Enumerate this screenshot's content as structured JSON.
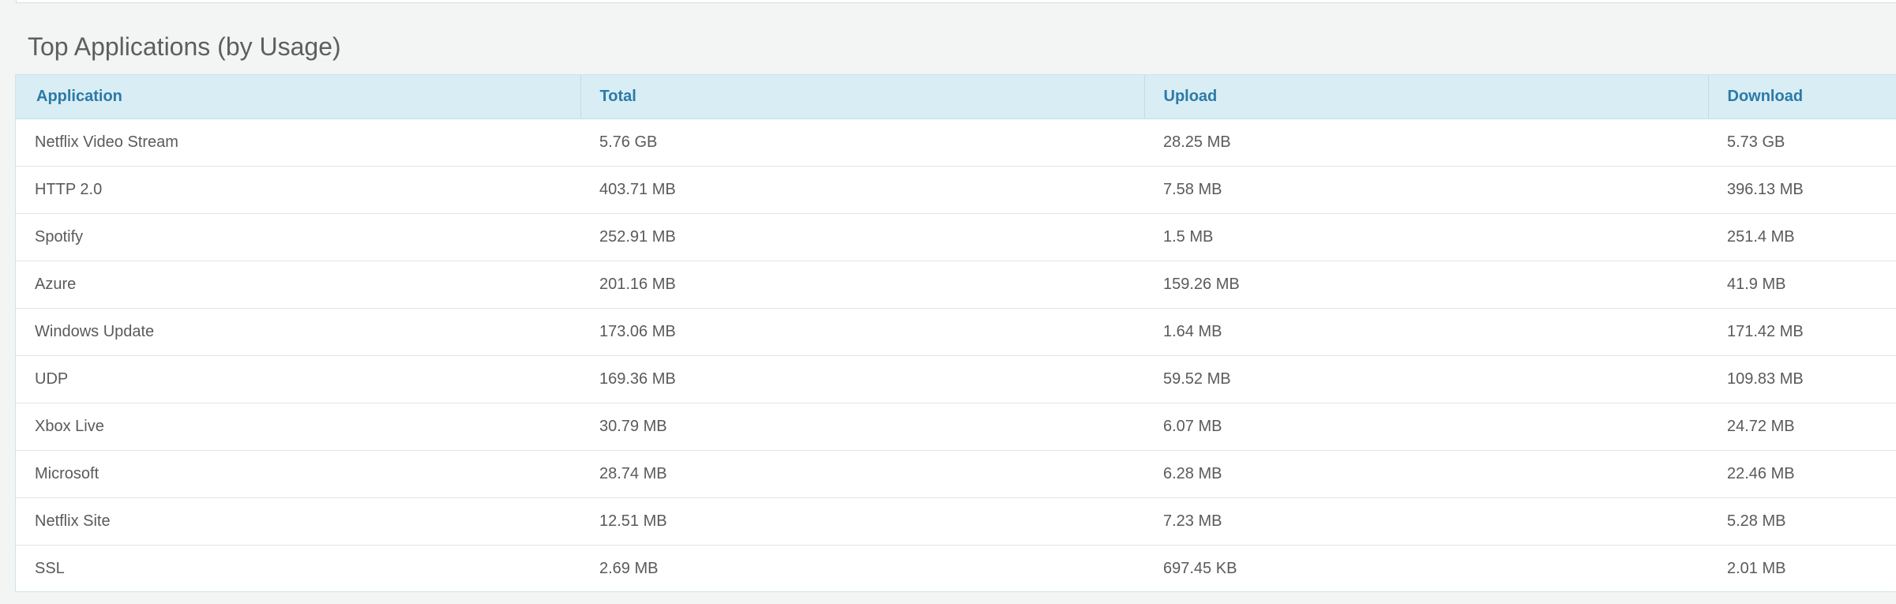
{
  "section": {
    "title": "Top Applications (by Usage)"
  },
  "table": {
    "headers": [
      "Application",
      "Total",
      "Upload",
      "Download"
    ],
    "rows": [
      [
        "Netflix Video Stream",
        "5.76 GB",
        "28.25 MB",
        "5.73 GB"
      ],
      [
        "HTTP 2.0",
        "403.71 MB",
        "7.58 MB",
        "396.13 MB"
      ],
      [
        "Spotify",
        "252.91 MB",
        "1.5 MB",
        "251.4 MB"
      ],
      [
        "Azure",
        "201.16 MB",
        "159.26 MB",
        "41.9 MB"
      ],
      [
        "Windows Update",
        "173.06 MB",
        "1.64 MB",
        "171.42 MB"
      ],
      [
        "UDP",
        "169.36 MB",
        "59.52 MB",
        "109.83 MB"
      ],
      [
        "Xbox Live",
        "30.79 MB",
        "6.07 MB",
        "24.72 MB"
      ],
      [
        "Microsoft",
        "28.74 MB",
        "6.28 MB",
        "22.46 MB"
      ],
      [
        "Netflix Site",
        "12.51 MB",
        "7.23 MB",
        "5.28 MB"
      ],
      [
        "SSL",
        "2.69 MB",
        "697.45 KB",
        "2.01 MB"
      ]
    ]
  },
  "colors": {
    "page_background": "#f3f5f4",
    "header_background": "#d9edf4",
    "header_text": "#2b7aa8",
    "body_text": "#5a5a5a"
  }
}
